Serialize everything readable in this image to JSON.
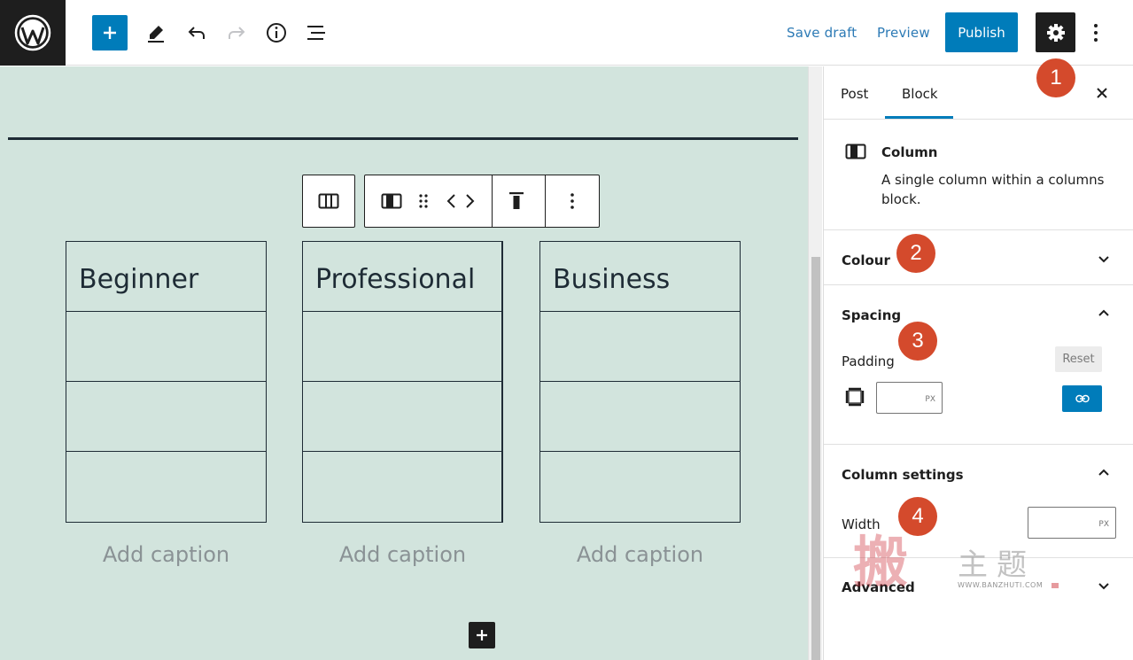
{
  "toolbar": {
    "save_draft": "Save draft",
    "preview": "Preview",
    "publish": "Publish",
    "icons": [
      "wordpress-logo",
      "plus-icon",
      "pencil-icon",
      "undo-icon",
      "redo-icon",
      "info-icon",
      "list-view-icon",
      "gear-icon",
      "more-vertical-icon"
    ]
  },
  "canvas": {
    "background": "#d2e4dd",
    "tables": [
      {
        "heading": "Beginner",
        "caption": "Add caption"
      },
      {
        "heading": "Professional",
        "caption": "Add caption"
      },
      {
        "heading": "Business",
        "caption": "Add caption"
      }
    ]
  },
  "sidebar": {
    "tabs": [
      "Post",
      "Block"
    ],
    "active_tab": "Block",
    "block": {
      "name": "Column",
      "description": "A single column within a columns block."
    },
    "panels": {
      "colour": "Colour",
      "spacing": "Spacing",
      "padding_label": "Padding",
      "reset": "Reset",
      "padding_unit": "PX",
      "column_settings": "Column settings",
      "width_label": "Width",
      "width_unit": "PX",
      "advanced": "Advanced"
    }
  },
  "annotations": [
    "1",
    "2",
    "3",
    "4"
  ],
  "watermark": {
    "big_char": "搬",
    "text": "主题",
    "url": "WWW.BANZHUTI.COM"
  },
  "colors": {
    "accent": "#007cba",
    "badge": "#d44a2c",
    "dark": "#1e1e1e"
  }
}
